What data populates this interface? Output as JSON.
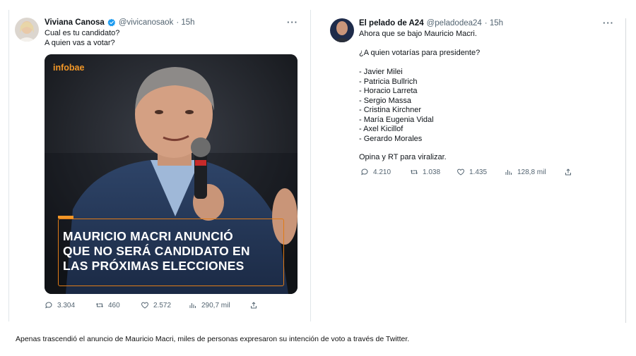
{
  "left_tweet": {
    "name": "Viviana Canosa",
    "handle": "@vivicanosaok",
    "time": "· 15h",
    "more": "···",
    "lines": [
      "Cual es tu candidato?",
      "A quien vas a votar?"
    ],
    "media": {
      "brand": "infobae",
      "headline_lines": [
        "MAURICIO MACRI ANUNCIÓ",
        "QUE NO SERÁ CANDIDATO EN",
        "LAS PRÓXIMAS ELECCIONES"
      ]
    },
    "actions": {
      "replies": "3.304",
      "retweets": "460",
      "likes": "2.572",
      "views": "290,7 mil"
    }
  },
  "right_tweet": {
    "name": "El pelado de A24",
    "handle": "@peladodea24",
    "time": "· 15h",
    "more": "···",
    "intro": "Ahora que se bajo Mauricio Macri.",
    "question": "¿A quien votarías para presidente?",
    "candidates": [
      "- Javier Milei",
      "- Patricia Bullrich",
      "- Horacio Larreta",
      "- Sergio Massa",
      "- Cristina Kirchner",
      "- María Eugenia Vidal",
      "- Axel Kicillof",
      "- Gerardo Morales"
    ],
    "outro": "Opina y RT para viralizar.",
    "actions": {
      "replies": "4.210",
      "retweets": "1.038",
      "likes": "1.435",
      "views": "128,8 mil"
    }
  },
  "caption": "Apenas trascendió el anuncio de Mauricio Macri, miles de personas expresaron su intención de voto a través de Twitter.",
  "colors": {
    "verified": "#1d9bf0",
    "infobae_orange": "#f29727",
    "muted": "#536471"
  }
}
